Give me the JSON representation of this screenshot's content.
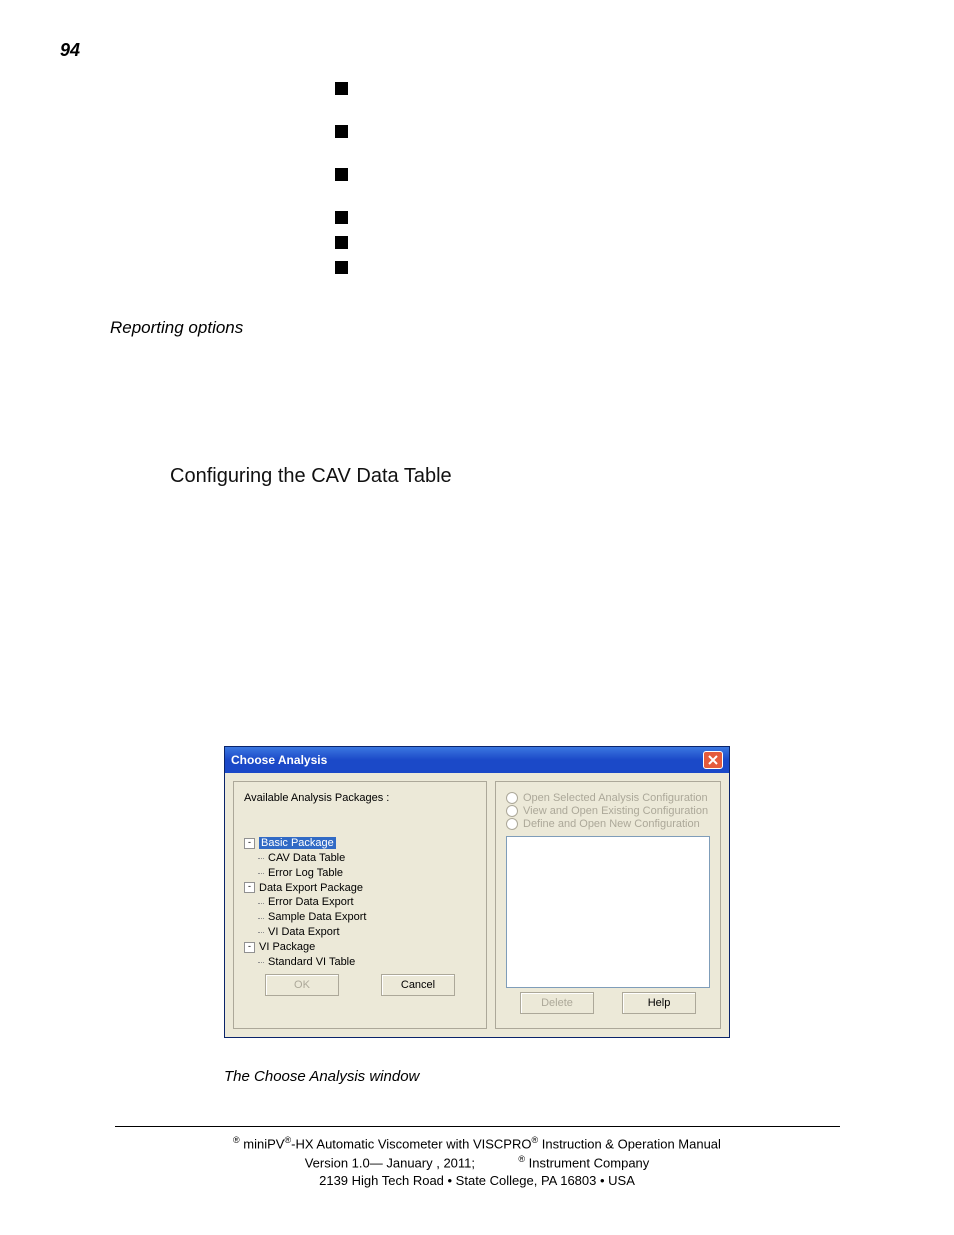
{
  "page_number": "94",
  "section_label": "Reporting options",
  "heading": "Configuring the CAV Data Table",
  "dialog": {
    "title": "Choose Analysis",
    "available_label": "Available Analysis Packages :",
    "tree": {
      "basic": "Basic Package",
      "cav": "CAV Data Table",
      "errorlog": "Error Log Table",
      "dep": "Data Export Package",
      "ede": "Error Data Export",
      "sde": "Sample Data Export",
      "vde": "VI Data Export",
      "vip": "VI Package",
      "svt": "Standard VI Table"
    },
    "radios": {
      "r1": "Open Selected Analysis Configuration",
      "r2": "View and Open Existing Configuration",
      "r3": "Define and Open New Configuration"
    },
    "buttons": {
      "ok": "OK",
      "cancel": "Cancel",
      "delete": "Delete",
      "help": "Help"
    }
  },
  "caption": "The Choose Analysis window",
  "footer": {
    "line1_a": " miniPV",
    "line1_b": "-HX Automatic Viscometer with VISCPRO",
    "line1_c": " Instruction & Operation Manual",
    "line2_a": "Version 1.0— January , 2011;",
    "line2_b": " Instrument Company",
    "line3": "2139 High Tech Road • State College, PA  16803 • USA"
  }
}
